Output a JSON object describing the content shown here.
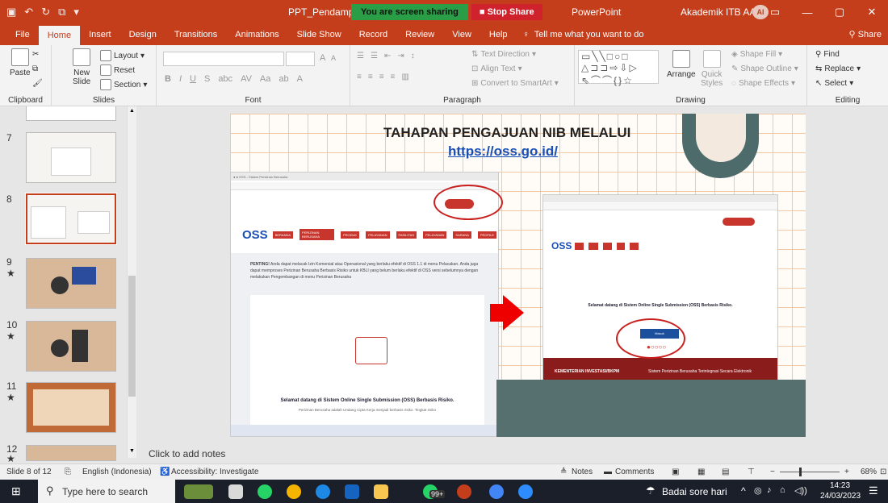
{
  "titlebar": {
    "doc_title": "PPT_Pendampinga",
    "sharing": "You are screen sharing",
    "stop_share": "Stop Share",
    "app": "PowerPoint",
    "account": "Akademik ITB AAS",
    "avatar": "AI"
  },
  "menu": {
    "tabs": [
      "File",
      "Home",
      "Insert",
      "Design",
      "Transitions",
      "Animations",
      "Slide Show",
      "Record",
      "Review",
      "View",
      "Help"
    ],
    "tell_me": "Tell me what you want to do",
    "share": "Share"
  },
  "ribbon": {
    "clipboard": {
      "paste": "Paste",
      "label": "Clipboard"
    },
    "slides": {
      "new_slide": "New",
      "new_slide2": "Slide",
      "layout": "Layout",
      "reset": "Reset",
      "section": "Section",
      "label": "Slides"
    },
    "font": {
      "label": "Font",
      "bold": "B",
      "italic": "I",
      "underline": "U",
      "strike": "S",
      "abc": "abc",
      "case": "Aa",
      "grow": "A",
      "shrink": "A"
    },
    "paragraph": {
      "label": "Paragraph",
      "text_direction": "Text Direction",
      "align_text": "Align Text",
      "smartart": "Convert to SmartArt"
    },
    "drawing": {
      "label": "Drawing",
      "arrange": "Arrange",
      "quick_styles": "Quick",
      "quick_styles2": "Styles",
      "fill": "Shape Fill",
      "outline": "Shape Outline",
      "effects": "Shape Effects"
    },
    "editing": {
      "label": "Editing",
      "find": "Find",
      "replace": "Replace",
      "select": "Select"
    }
  },
  "slide_panel": {
    "numbers": [
      "7",
      "8",
      "9",
      "10",
      "11",
      "12"
    ]
  },
  "slide": {
    "title": "TAHAPAN PENGAJUAN NIB MELALUI",
    "link": "https://oss.go.id/",
    "left_shot": {
      "logo": "OSS",
      "nav": [
        "BERANDA",
        "PERIZINAN BERUSAHA",
        "PRODUK",
        "PELAYANAN",
        "FASILITAS",
        "PELAYANAN",
        "SARANA",
        "PROFILE"
      ],
      "notice_bold": "PENTING!",
      "notice": "Anda dapat melacak Izin Komersial atau Operasional yang berlaku efektif di OSS 1.1 di menu Pelacakan. Anda juga dapat memproses Perizinan Berusaha Berbasis Risiko untuk KBLI yang belum berlaku efektif di OSS versi sebelumnya dengan melakukan Pengembangan di menu Perizinan Berusaha",
      "welcome": "Selamat datang di Sistem Online Single Submission (OSS) Berbasis Risiko.",
      "sub": "Perizinan Berusaha adalah Undang Cipta Kerja menjadi berbasis risiko. Tingkat risiko"
    },
    "right_shot": {
      "logo": "OSS",
      "welcome": "Selamat datang di Sistem Online Single Submission (OSS) Berbasis Risiko.",
      "button": "Masuk",
      "footer": "KEMENTERIAN INVESTASI/BKPM",
      "footer_right": "Sistem Perizinan Berusaha Terintegrasi Secara Elektronik"
    },
    "deco_colors": [
      "#f3e9de",
      "#a0522d",
      "#e0a040",
      "#c0606a",
      "#4a7070"
    ]
  },
  "notes": {
    "placeholder": "Click to add notes"
  },
  "status": {
    "slide": "Slide 8 of 12",
    "language": "English (Indonesia)",
    "accessibility": "Accessibility: Investigate",
    "notes": "Notes",
    "comments": "Comments",
    "zoom": "68%"
  },
  "taskbar": {
    "search": "Type here to search",
    "weather": "Badai sore hari",
    "time": "14:23",
    "date": "24/03/2023",
    "badge": "99+"
  }
}
